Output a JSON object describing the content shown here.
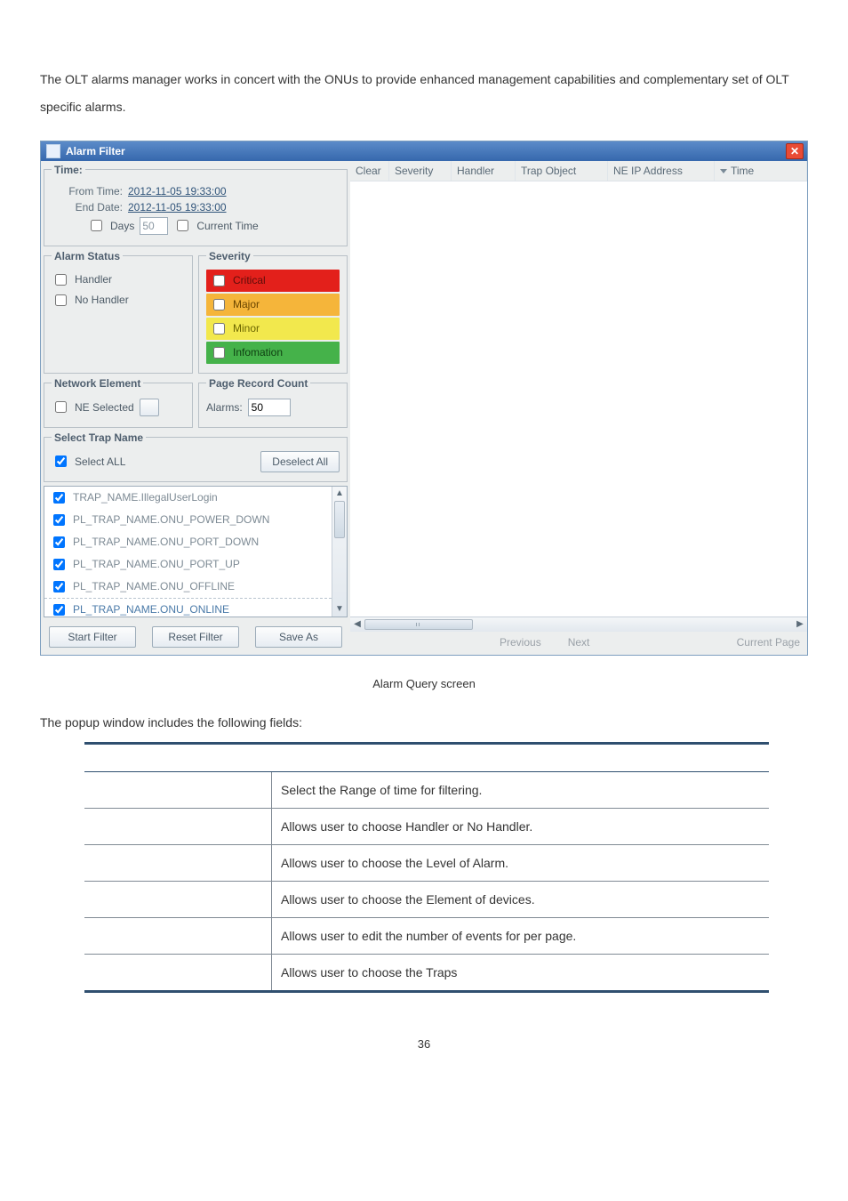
{
  "intro": "The OLT alarms manager works in concert with the ONUs to provide enhanced management capabilities and complementary set of OLT specific alarms.",
  "dialog": {
    "title": "Alarm Filter",
    "timeGroup": {
      "legend": "Time:",
      "fromLabel": "From Time:",
      "fromValue": "2012-11-05 19:33:00",
      "endLabel": "End Date:",
      "endValue": "2012-11-05 19:33:00",
      "daysLabel": "Days",
      "daysValue": "50",
      "currentTimeLabel": "Current Time"
    },
    "alarmStatus": {
      "legend": "Alarm Status",
      "handler": "Handler",
      "noHandler": "No Handler"
    },
    "severity": {
      "legend": "Severity",
      "critical": "Critical",
      "major": "Major",
      "minor": "Minor",
      "info": "Infomation"
    },
    "networkElement": {
      "legend": "Network Element",
      "neSelected": "NE Selected"
    },
    "pageRecord": {
      "legend": "Page Record Count",
      "alarmsLabel": "Alarms:",
      "alarmsValue": "50"
    },
    "selectTrap": {
      "legend": "Select Trap Name",
      "selectAll": "Select ALL",
      "deselect": "Deselect All",
      "items": [
        "TRAP_NAME.IllegalUserLogin",
        "PL_TRAP_NAME.ONU_POWER_DOWN",
        "PL_TRAP_NAME.ONU_PORT_DOWN",
        "PL_TRAP_NAME.ONU_PORT_UP",
        "PL_TRAP_NAME.ONU_OFFLINE",
        "PL_TRAP_NAME.ONU_ONLINE"
      ]
    },
    "buttons": {
      "start": "Start Filter",
      "reset": "Reset Filter",
      "save": "Save As"
    },
    "columns": {
      "clear": "Clear",
      "severity": "Severity",
      "handler": "Handler",
      "trap": "Trap Object",
      "neip": "NE IP Address",
      "time": "Time"
    },
    "pager": {
      "prev": "Previous",
      "next": "Next",
      "current": "Current Page"
    }
  },
  "caption": "Alarm Query screen",
  "lead": "The popup window includes the following fields:",
  "descTable": {
    "rows": [
      {
        "k": "",
        "v": "Select the Range of time for filtering."
      },
      {
        "k": "",
        "v": "Allows user to choose Handler or No Handler."
      },
      {
        "k": "",
        "v": "Allows user to choose the Level of Alarm."
      },
      {
        "k": "",
        "v": "Allows user to choose the Element of devices."
      },
      {
        "k": "",
        "v": "Allows user to edit the number of events for per page."
      },
      {
        "k": "",
        "v": "Allows user to choose the Traps"
      }
    ]
  },
  "pageNumber": "36"
}
